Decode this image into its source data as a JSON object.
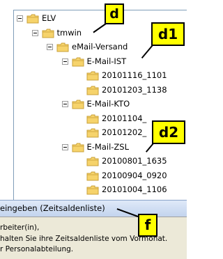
{
  "tree": {
    "nodes": [
      {
        "label": "ELV",
        "indent": 0,
        "type": "expanded"
      },
      {
        "label": "tmwin",
        "indent": 1,
        "type": "expanded"
      },
      {
        "label": "eMail-Versand",
        "indent": 2,
        "type": "expanded"
      },
      {
        "label": "E-Mail-IST",
        "indent": 3,
        "type": "expanded"
      },
      {
        "label": "20101116_1101",
        "indent": 4,
        "type": "leaf"
      },
      {
        "label": "20101203_1138",
        "indent": 4,
        "type": "leaf"
      },
      {
        "label": "E-Mail-KTO",
        "indent": 3,
        "type": "expanded"
      },
      {
        "label": "20101104_",
        "indent": 4,
        "type": "leaf"
      },
      {
        "label": "20101202_",
        "indent": 4,
        "type": "leaf"
      },
      {
        "label": "E-Mail-ZSL",
        "indent": 3,
        "type": "expanded"
      },
      {
        "label": "20100801_1635",
        "indent": 4,
        "type": "leaf"
      },
      {
        "label": "20100904_0920",
        "indent": 4,
        "type": "leaf"
      },
      {
        "label": "20101004_1106",
        "indent": 4,
        "type": "leaf"
      }
    ]
  },
  "callouts": {
    "d": "d",
    "d1": "d1",
    "d2": "d2",
    "f": "f"
  },
  "dialog": {
    "title": "eingeben (Zeitsaldenliste)",
    "body_lines": [
      "rbeiter(in),",
      "halten Sie ihre Zeitsaldenliste vom Vormonat.",
      "r Personalabteilung."
    ]
  },
  "colors": {
    "callout_fill": "#ffff00",
    "folder_fill": "#f6d36b",
    "folder_edge": "#c9a038",
    "dialog_title_bg": "#c3d4ee"
  }
}
